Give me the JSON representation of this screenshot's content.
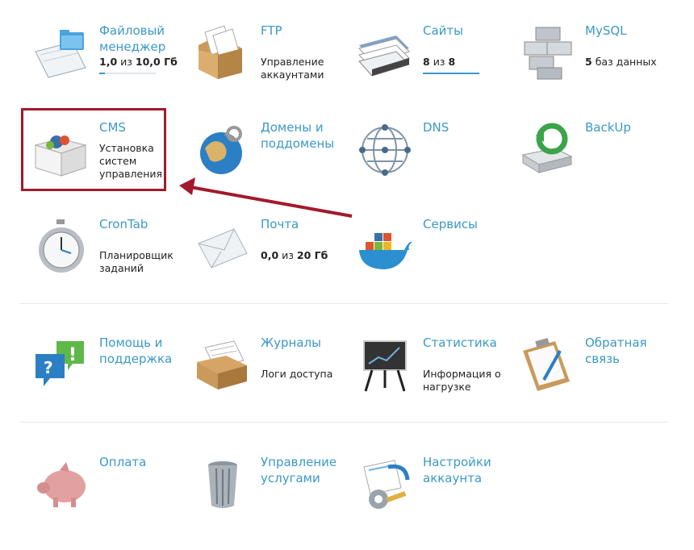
{
  "tiles": {
    "file_manager": {
      "title": "Файловый менеджер",
      "used": "1,0",
      "sep": "из",
      "total": "10,0 Гб",
      "progress": 0.1
    },
    "ftp": {
      "title": "FTP",
      "desc": "Управление аккаунтами"
    },
    "sites": {
      "title": "Сайты",
      "used": "8",
      "sep": "из",
      "total": "8",
      "progress": 1.0
    },
    "mysql": {
      "title": "MySQL",
      "count": "5",
      "desc": "баз данных"
    },
    "cms": {
      "title": "CMS",
      "desc": "Установка систем управления"
    },
    "domains": {
      "title": "Домены и поддомены"
    },
    "dns": {
      "title": "DNS"
    },
    "backup": {
      "title": "BackUp"
    },
    "crontab": {
      "title": "CronTab",
      "desc": "Планировщик заданий"
    },
    "mail": {
      "title": "Почта",
      "used": "0,0",
      "sep": "из",
      "total": "20 Гб"
    },
    "services": {
      "title": "Сервисы"
    },
    "support": {
      "title": "Помощь и поддержка"
    },
    "logs": {
      "title": "Журналы",
      "desc": "Логи доступа"
    },
    "stats": {
      "title": "Статистика",
      "desc": "Информация о нагрузке"
    },
    "feedback": {
      "title": "Обратная связь"
    },
    "payment": {
      "title": "Оплата"
    },
    "service_mgmt": {
      "title": "Управление услугами"
    },
    "account_settings": {
      "title": "Настройки аккаунта"
    }
  },
  "icons": [
    "folder-icon",
    "ftp-folder-icon",
    "sites-icon",
    "database-icon",
    "cms-box-icon",
    "globe-keys-icon",
    "dns-network-icon",
    "backup-disk-icon",
    "clock-icon",
    "mail-envelope-icon",
    "docker-whale-icon",
    "help-bubbles-icon",
    "logs-box-icon",
    "stats-easel-icon",
    "clipboard-icon",
    "piggy-bank-icon",
    "trash-bin-icon",
    "settings-gear-icon"
  ],
  "colors": {
    "link": "#3b99c7",
    "highlight": "#a3192b",
    "text": "#222222"
  }
}
